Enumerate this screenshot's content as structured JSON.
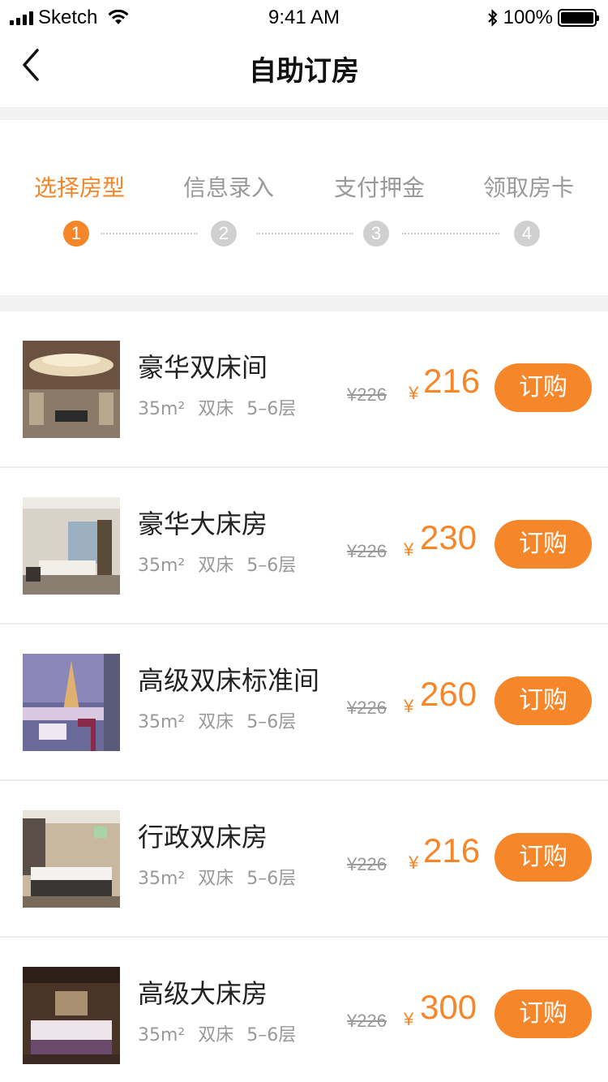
{
  "status": {
    "carrier": "Sketch",
    "time": "9:41 AM",
    "battery": "100%"
  },
  "nav": {
    "title": "自助订房"
  },
  "steps": [
    {
      "label": "选择房型",
      "number": "1",
      "active": true
    },
    {
      "label": "信息录入",
      "number": "2",
      "active": false
    },
    {
      "label": "支付押金",
      "number": "3",
      "active": false
    },
    {
      "label": "领取房卡",
      "number": "4",
      "active": false
    }
  ],
  "rooms": [
    {
      "name": "豪华双床间",
      "area": "35m²",
      "bed": "双床",
      "floor": "5–6层",
      "old_price": "¥226",
      "currency": "¥",
      "price": "216",
      "button": "订购"
    },
    {
      "name": "豪华大床房",
      "area": "35m²",
      "bed": "双床",
      "floor": "5–6层",
      "old_price": "¥226",
      "currency": "¥",
      "price": "230",
      "button": "订购"
    },
    {
      "name": "高级双床标准间",
      "area": "35m²",
      "bed": "双床",
      "floor": "5–6层",
      "old_price": "¥226",
      "currency": "¥",
      "price": "260",
      "button": "订购"
    },
    {
      "name": "行政双床房",
      "area": "35m²",
      "bed": "双床",
      "floor": "5–6层",
      "old_price": "¥226",
      "currency": "¥",
      "price": "216",
      "button": "订购"
    },
    {
      "name": "高级大床房",
      "area": "35m²",
      "bed": "双床",
      "floor": "5–6层",
      "old_price": "¥226",
      "currency": "¥",
      "price": "300",
      "button": "订购"
    }
  ],
  "colors": {
    "accent": "#f5862a",
    "muted": "#999999",
    "divider": "#f2f2f2"
  }
}
